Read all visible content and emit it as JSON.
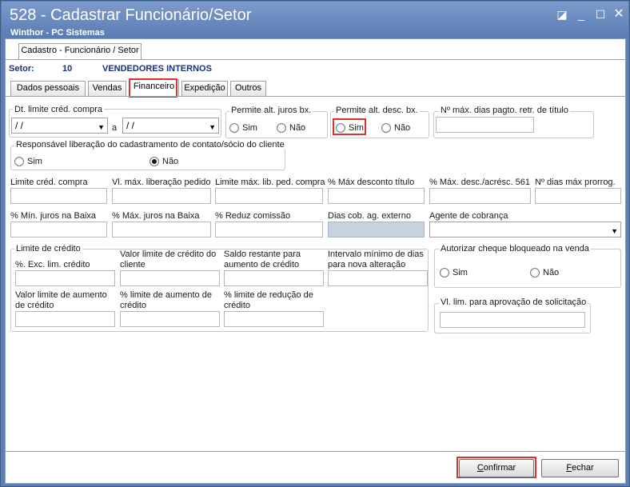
{
  "window": {
    "title": "528 - Cadastrar Funcionário/Setor",
    "subtitle": "Winthor - PC Sistemas",
    "controls": [
      "restore-icon",
      "minimize-icon",
      "maximize-icon",
      "close-icon"
    ]
  },
  "top_tab": {
    "label": "Cadastro - Funcionário / Setor"
  },
  "setor": {
    "label": "Setor:",
    "code": "10",
    "name": "VENDEDORES INTERNOS"
  },
  "tabs": [
    {
      "label": "Dados pessoais"
    },
    {
      "label": "Vendas"
    },
    {
      "label": "Financeiro",
      "selected": true
    },
    {
      "label": "Expedição"
    },
    {
      "label": "Outros"
    }
  ],
  "form": {
    "dt_limite": {
      "label": "Dt. limite créd. compra",
      "from": "/ /",
      "sep": "a",
      "to": "/ /"
    },
    "juros": {
      "label": "Permite alt. juros bx.",
      "opt_yes": "Sim",
      "opt_no": "Não"
    },
    "desc": {
      "label": "Permite alt. desc. bx.",
      "opt_yes": "Sim",
      "opt_no": "Não"
    },
    "dias_pagto": {
      "label": "Nº máx. dias pagto. retr. de título",
      "value": ""
    },
    "resp": {
      "label": "Responsável liberação do cadastramento de contato/sócio do cliente",
      "opt_yes": "Sim",
      "opt_no": "Não",
      "selected": "Não"
    },
    "row1": [
      "Limite créd. compra",
      "Vl. máx. liberação pedido",
      "Limite máx. lib. ped. compra",
      "% Máx desconto título",
      "% Máx. desc./acrésc. 561",
      "Nº dias máx prorrog."
    ],
    "row2": [
      "% Mín. juros na Baixa",
      "% Máx. juros na Baixa",
      "% Reduz  comissão",
      "Dias cob. ag. externo",
      "Agente de cobrança"
    ],
    "credito": {
      "title": "Limite de crédito",
      "exc_label": "%. Exc. lim. crédito",
      "valor_lim_cli": "Valor limite de crédito do cliente",
      "saldo_rest": "Saldo restante para aumento de crédito",
      "intervalo": "Intervalo mínimo de dias para nova alteração",
      "valor_aum": "Valor limite de aumento de crédito",
      "pct_aum": "% limite de aumento de crédito",
      "pct_red": "% limite de redução de crédito"
    },
    "cheque": {
      "label": "Autorizar cheque bloqueado na venda",
      "opt_yes": "Sim",
      "opt_no": "Não"
    },
    "vl_lim_aprov": {
      "label": "Vl. lim. para aprovação de solicitação",
      "value": ""
    }
  },
  "footer": {
    "confirm": {
      "label": "Confirmar",
      "underline": "C",
      "rest": "onfirmar"
    },
    "close": {
      "label": "Fechar",
      "underline": "F",
      "rest": "echar"
    }
  },
  "highlight_color": "#e03030"
}
